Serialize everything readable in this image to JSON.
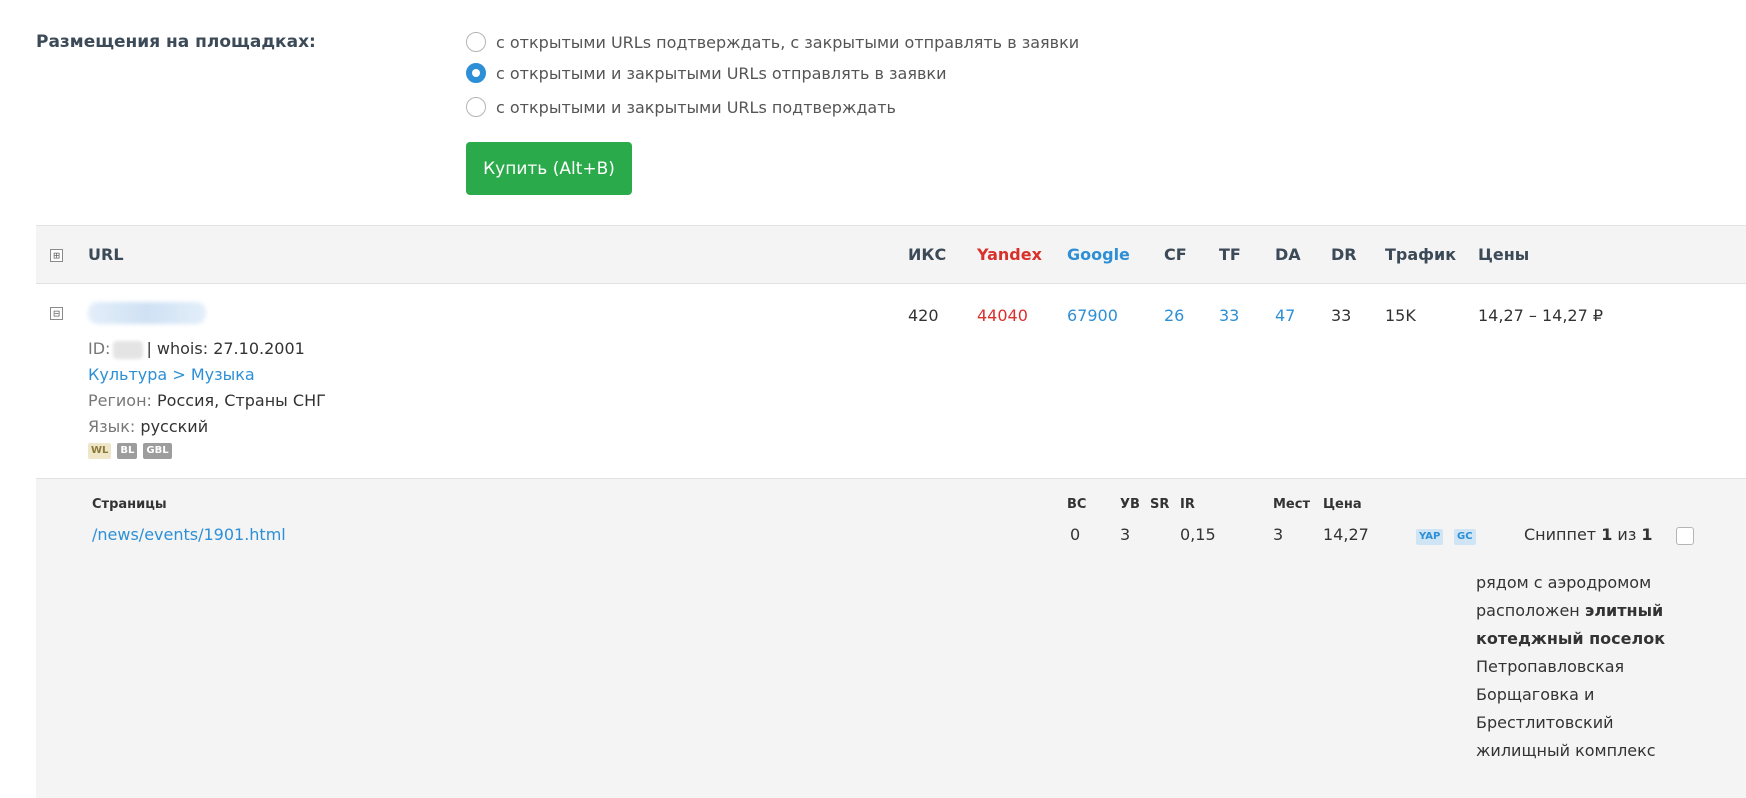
{
  "placement": {
    "label": "Размещения на площадках:",
    "options": [
      {
        "label": "с открытыми URLs подтверждать, с закрытыми отправлять в заявки",
        "checked": false
      },
      {
        "label": "с открытыми и закрытыми URLs отправлять в заявки",
        "checked": true
      },
      {
        "label": "с открытыми и закрытыми URLs подтверждать",
        "checked": false
      }
    ],
    "buy_button": "Купить (Alt+B)"
  },
  "table": {
    "header": {
      "expand_all_icon": "⊞",
      "url": "URL",
      "iks": "ИКС",
      "yandex": "Yandex",
      "google": "Google",
      "cf": "CF",
      "tf": "TF",
      "da": "DA",
      "dr": "DR",
      "traffic": "Трафик",
      "prices": "Цены"
    },
    "site": {
      "collapse_icon": "⊟",
      "iks": "420",
      "yandex": "44040",
      "google": "67900",
      "cf": "26",
      "tf": "33",
      "da": "47",
      "dr": "33",
      "traffic": "15K",
      "prices": "14,27 – 14,27 ₽",
      "id_label": "ID:",
      "whois": "| whois: 27.10.2001",
      "category": "Культура > Музыка",
      "region_label": "Регион:",
      "region": "Россия, Страны СНГ",
      "language_label": "Язык:",
      "language": "русский",
      "badges": [
        "WL",
        "BL",
        "GBL"
      ]
    },
    "pages": {
      "headers": {
        "pages": "Страницы",
        "bc": "ВС",
        "uv": "УВ",
        "sr": "SR",
        "ir": "IR",
        "places": "Мест",
        "price": "Цена"
      },
      "row": {
        "url": "/news/events/1901.html",
        "bc": "0",
        "uv": "3",
        "ir": "0,15",
        "places": "3",
        "price": "14,27",
        "tags": [
          "YAP",
          "GC"
        ],
        "snippet_prefix": "Сниппет ",
        "snippet_current": "1",
        "snippet_middle": " из ",
        "snippet_total": "1",
        "snippet_before": "рядом с аэродромом расположен ",
        "snippet_bold": "элитный котеджный поселок",
        "snippet_after": " Петропавловская Борщаговка и Брестлитовский жилищный комплекс"
      }
    }
  }
}
